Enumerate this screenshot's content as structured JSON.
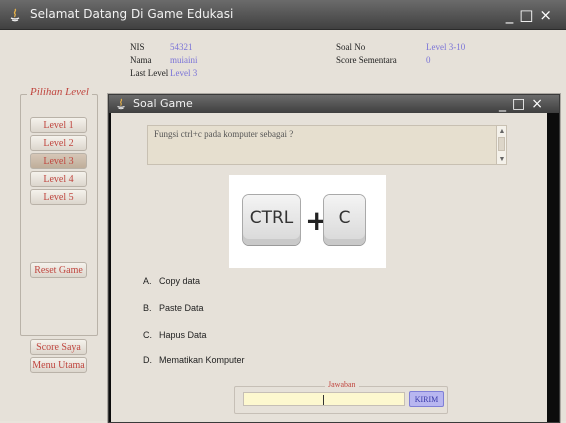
{
  "app": {
    "title": "Selamat Datang Di Game Edukasi",
    "window_controls": [
      "_",
      "□",
      "×"
    ]
  },
  "student_info": {
    "nis_label": "NIS",
    "nis_value": "54321",
    "nama_label": "Nama",
    "nama_value": "muiaini",
    "last_level_label": "Last Level",
    "last_level_value": "Level 3"
  },
  "progress_info": {
    "soal_no_label": "Soal No",
    "soal_no_value": "Level 3-10",
    "score_label": "Score Sementara",
    "score_value": "0"
  },
  "sidebar": {
    "legend": "Pilihan Level",
    "levels": [
      "Level 1",
      "Level 2",
      "Level 3",
      "Level 4",
      "Level 5"
    ],
    "selected_level": "Level 3",
    "reset_label": "Reset Game",
    "score_label": "Score Saya",
    "menu_label": "Menu Utama"
  },
  "dialog": {
    "title": "Soal Game",
    "window_controls": [
      "_",
      "□",
      "×"
    ],
    "question": "Fungsi ctrl+c pada komputer sebagai ?",
    "image_keys": {
      "left_key": "CTRL",
      "plus": "+",
      "right_key": "C"
    },
    "options": [
      {
        "letter": "A.",
        "text": "Copy data"
      },
      {
        "letter": "B.",
        "text": "Paste Data"
      },
      {
        "letter": "C.",
        "text": "Hapus Data"
      },
      {
        "letter": "D.",
        "text": "Mematikan Komputer"
      }
    ],
    "answer": {
      "legend": "Jawaban",
      "value": "",
      "submit_label": "KIRIM"
    }
  },
  "colors": {
    "accent_text": "#c0463f",
    "value_text": "#7a73d8",
    "button_kirim": "#b8b6f0",
    "answer_bg": "#fdf8cf",
    "titlebar": "#4a4a4a"
  }
}
